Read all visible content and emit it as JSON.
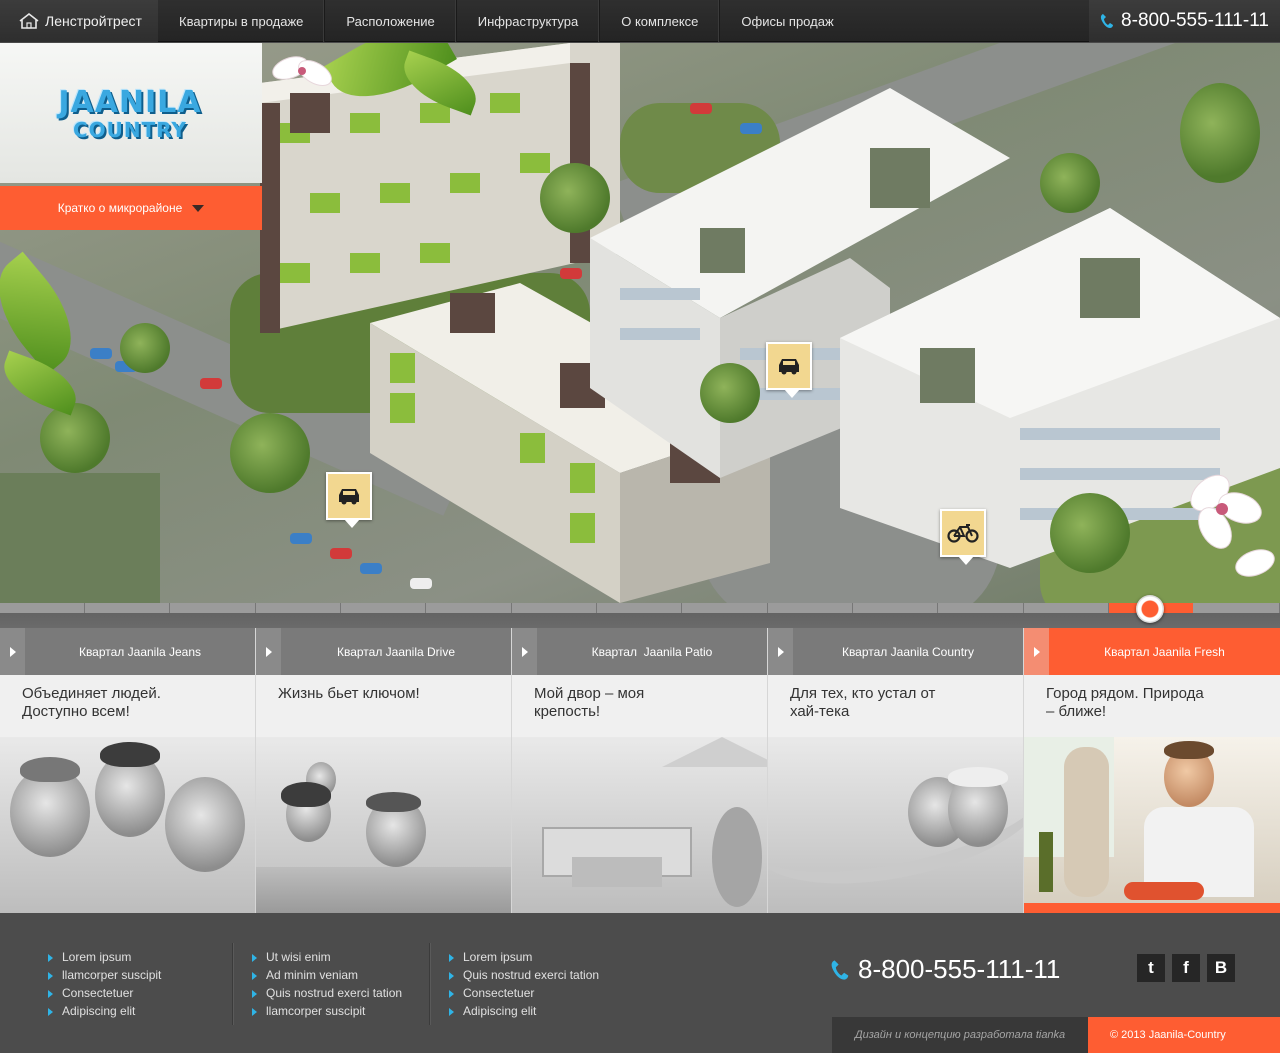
{
  "header": {
    "brand": "Ленстройтрест",
    "nav": [
      "Квартиры в продаже",
      "Расположение",
      "Инфраструктура",
      "О комплексе",
      "Офисы продаж"
    ],
    "phone": "8-800-555-111-11"
  },
  "logo": {
    "line1": "JAANILA",
    "line2": "COUNTRY"
  },
  "hero": {
    "about_button": "Кратко о микрорайоне",
    "pins": [
      "car-icon",
      "car-icon",
      "bicycle-icon"
    ]
  },
  "slider": {
    "active_index": 4
  },
  "cards": [
    {
      "title": "Квартал Jaanila Jeans",
      "text": "Объединяет людей.\nДоступно всем!"
    },
    {
      "title": "Квартал Jaanila Drive",
      "text": "Жизнь бьет ключом!"
    },
    {
      "title": "Квартал  Jaanila Patio",
      "text": "Мой двор – моя\nкрепость!"
    },
    {
      "title": "Квартал Jaanila Country",
      "text": "Для тех, кто устал от\nхай-тека"
    },
    {
      "title": "Квартал Jaanila Fresh",
      "text": "Город рядом. Природа\n– ближе!"
    }
  ],
  "footer": {
    "col1": [
      "Lorem ipsum",
      "llamcorper suscipit",
      "Consectetuer",
      "Adipiscing elit"
    ],
    "col2": [
      "Ut wisi enim",
      "Ad minim veniam",
      "Quis nostrud exerci tation",
      "llamcorper suscipit"
    ],
    "col3": [
      "Lorem ipsum",
      "Quis nostrud exerci tation",
      "Consectetuer",
      "Adipiscing elit"
    ],
    "phone": "8-800-555-111-11",
    "social": [
      "t",
      "f",
      "B"
    ],
    "credit": "Дизайн и концепцию разработала tianka",
    "copyright": "© 2013 Jaanila-Country"
  },
  "colors": {
    "accent": "#fe5d32",
    "link_marker": "#2fb4e6",
    "pin": "#f2d790"
  }
}
